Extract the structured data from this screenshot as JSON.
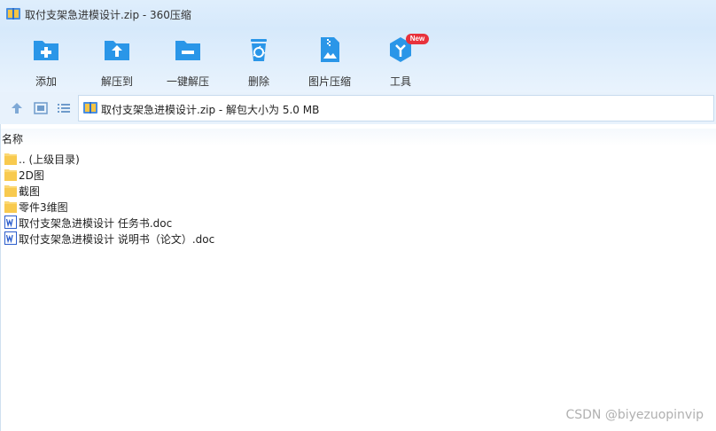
{
  "window": {
    "title": "取付支架急进模设计.zip - 360压缩"
  },
  "toolbar": {
    "buttons": [
      {
        "label": "添加",
        "icon": "add-folder-icon"
      },
      {
        "label": "解压到",
        "icon": "extract-to-icon"
      },
      {
        "label": "一键解压",
        "icon": "one-click-extract-icon"
      },
      {
        "label": "删除",
        "icon": "delete-icon"
      },
      {
        "label": "图片压缩",
        "icon": "image-compress-icon"
      },
      {
        "label": "工具",
        "icon": "tools-icon",
        "badge": "New"
      }
    ]
  },
  "address": {
    "icon": "zip-archive-icon",
    "text": "取付支架急进模设计.zip - 解包大小为 5.0 MB"
  },
  "filelist": {
    "header": "名称",
    "items": [
      {
        "name": ".. (上级目录)",
        "type": "folder"
      },
      {
        "name": "2D图",
        "type": "folder"
      },
      {
        "name": "截图",
        "type": "folder"
      },
      {
        "name": "零件3维图",
        "type": "folder"
      },
      {
        "name": "取付支架急进模设计 任务书.doc",
        "type": "doc"
      },
      {
        "name": "取付支架急进模设计 说明书（论文）.doc",
        "type": "doc"
      }
    ]
  },
  "watermark": "CSDN @biyezuopinvip",
  "colors": {
    "accent_blue": "#2a96e8",
    "folder_yellow": "#fbd874",
    "badge_red": "#e8323c",
    "word_blue": "#2b5dcc"
  }
}
